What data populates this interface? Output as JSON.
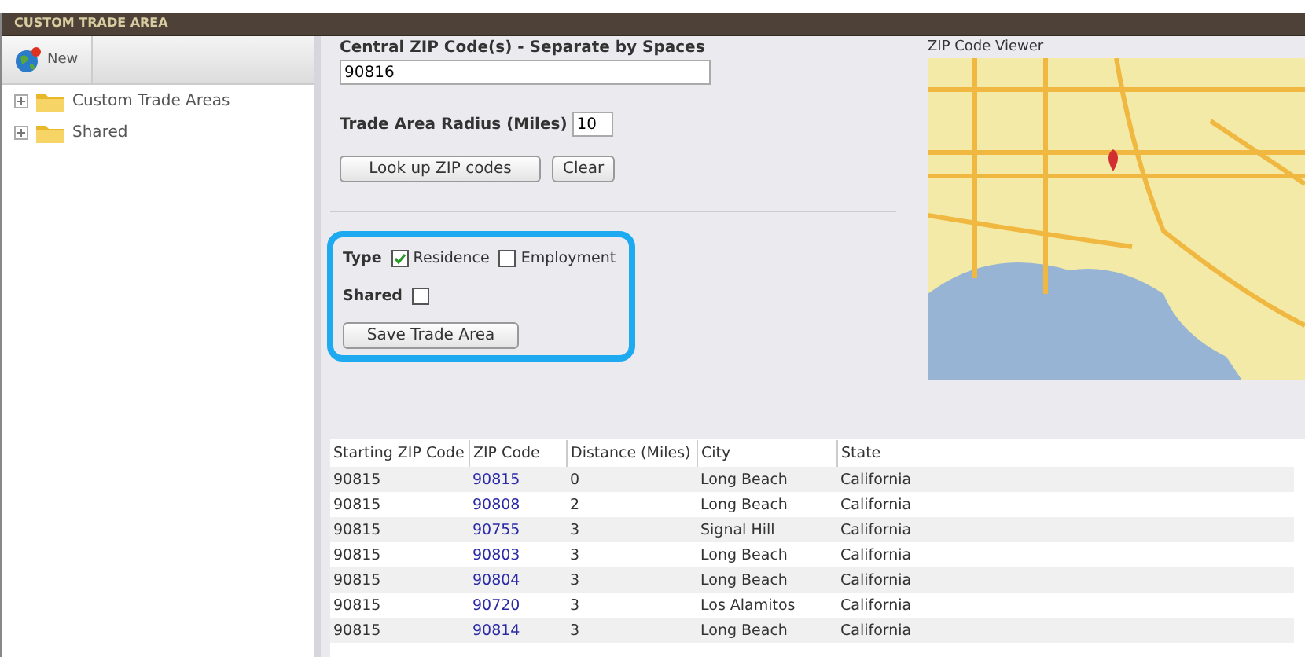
{
  "window": {
    "title": "CUSTOM TRADE AREA"
  },
  "sidebar": {
    "new_button": "New",
    "tree": [
      {
        "label": "Custom Trade Areas",
        "expanded": false
      },
      {
        "label": "Shared",
        "expanded": false
      }
    ]
  },
  "form": {
    "zip_label": "Central ZIP Code(s) - Separate by Spaces",
    "zip_value": "90816",
    "radius_label": "Trade Area Radius (Miles)",
    "radius_value": "10",
    "buttons": [
      "Look up ZIP codes",
      "Clear"
    ],
    "type_label": "Type",
    "types": [
      {
        "label": "Residence",
        "checked": true
      },
      {
        "label": "Employment",
        "checked": false
      }
    ],
    "shared_label": "Shared",
    "shared": {
      "checked": false
    },
    "save_button": "Save Trade Area"
  },
  "map": {
    "title": "ZIP Code Viewer"
  },
  "table": {
    "columns": [
      "Starting ZIP Code",
      "ZIP Code",
      "Distance (Miles)",
      "City",
      "State"
    ],
    "rows": [
      [
        "90815",
        "90815",
        "0",
        "Long Beach",
        "California"
      ],
      [
        "90815",
        "90808",
        "2",
        "Long Beach",
        "California"
      ],
      [
        "90815",
        "90755",
        "3",
        "Signal Hill",
        "California"
      ],
      [
        "90815",
        "90803",
        "3",
        "Long Beach",
        "California"
      ],
      [
        "90815",
        "90804",
        "3",
        "Long Beach",
        "California"
      ],
      [
        "90815",
        "90720",
        "3",
        "Los Alamitos",
        "California"
      ],
      [
        "90815",
        "90814",
        "3",
        "Long Beach",
        "California"
      ]
    ]
  }
}
